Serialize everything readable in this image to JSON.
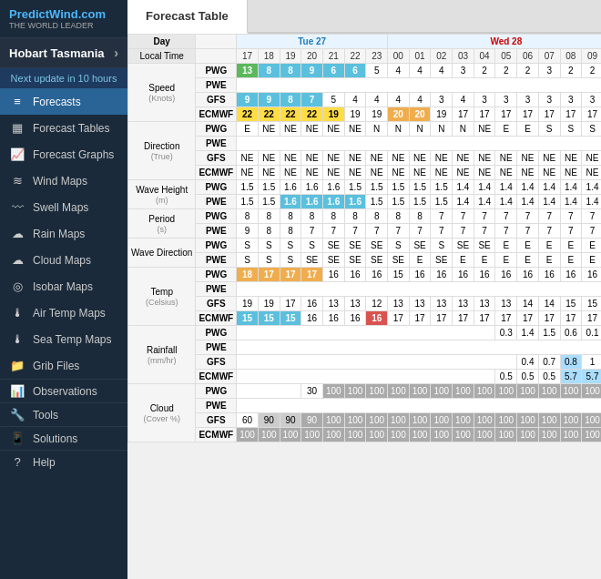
{
  "logo": {
    "main": "PredictWind.com",
    "sub": "THE WORLD LEADER"
  },
  "location": "Hobart Tasmania",
  "nextUpdate": "Next update in 10 hours",
  "tabs": {
    "forecastTable": "Forecast Table"
  },
  "sidebar": {
    "items": [
      {
        "label": "Forecasts",
        "icon": "≡",
        "active": true
      },
      {
        "label": "Forecast Tables",
        "icon": "▦"
      },
      {
        "label": "Forecast Graphs",
        "icon": "📈"
      },
      {
        "label": "Wind Maps",
        "icon": "≋"
      },
      {
        "label": "Swell Maps",
        "icon": "〰"
      },
      {
        "label": "Rain Maps",
        "icon": "☁"
      },
      {
        "label": "Cloud Maps",
        "icon": "☁"
      },
      {
        "label": "Isobar Maps",
        "icon": "◎"
      },
      {
        "label": "Air Temp Maps",
        "icon": "🌡"
      },
      {
        "label": "Sea Temp Maps",
        "icon": "🌡"
      },
      {
        "label": "Grib Files",
        "icon": "📁"
      },
      {
        "label": "Observations",
        "icon": "📊"
      },
      {
        "label": "Tools",
        "icon": "🔧"
      },
      {
        "label": "Solutions",
        "icon": "📱"
      },
      {
        "label": "Help",
        "icon": "?"
      }
    ]
  }
}
